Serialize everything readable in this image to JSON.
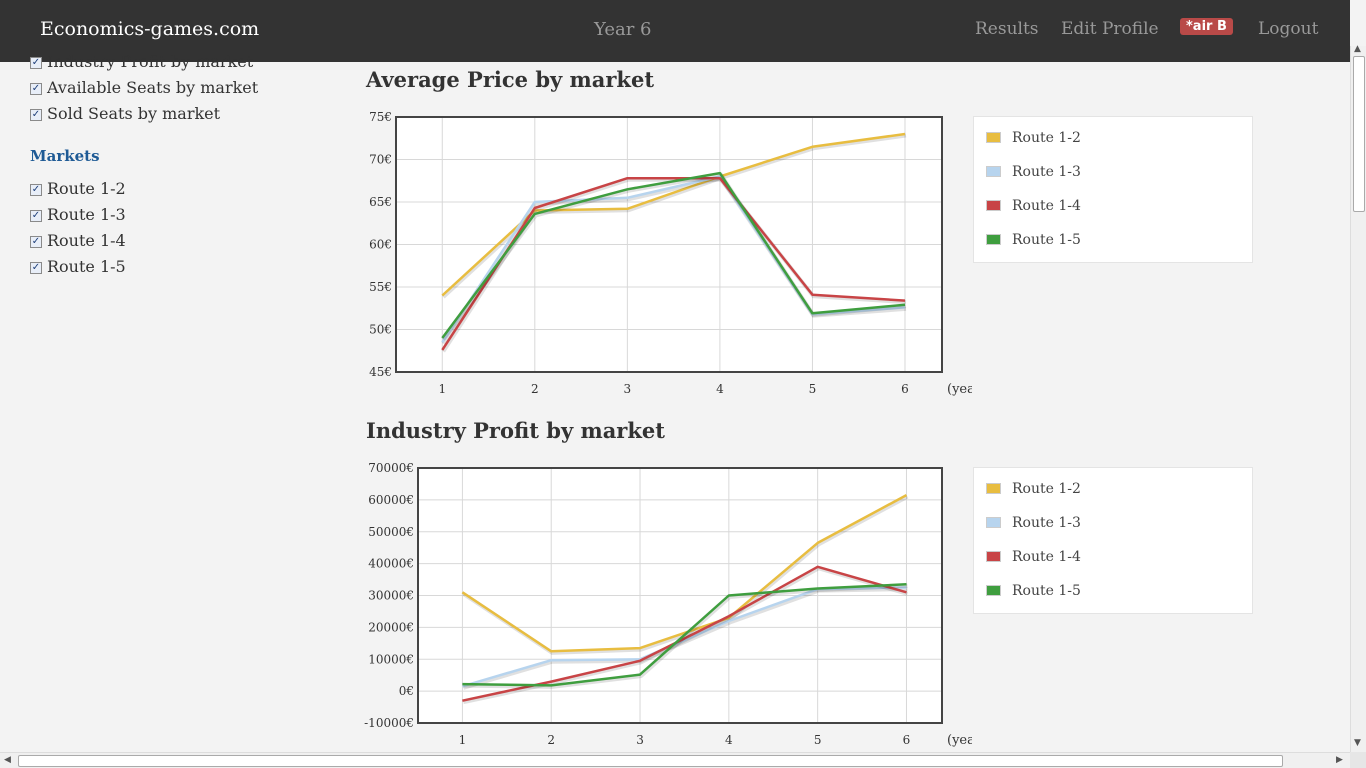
{
  "navbar": {
    "brand": "Economics-games.com",
    "year": "Year 6",
    "links": [
      "Results",
      "Edit Profile",
      "Logout"
    ],
    "badge": "*air B"
  },
  "sidebar": {
    "metric_options": [
      {
        "label": "Industry Profit by market",
        "checked": true
      },
      {
        "label": "Available Seats by market",
        "checked": true
      },
      {
        "label": "Sold Seats by market",
        "checked": true
      }
    ],
    "markets_heading": "Markets",
    "markets": [
      {
        "label": "Route 1-2",
        "checked": true
      },
      {
        "label": "Route 1-3",
        "checked": true
      },
      {
        "label": "Route 1-4",
        "checked": true
      },
      {
        "label": "Route 1-5",
        "checked": true
      }
    ]
  },
  "colors": {
    "route_1_2": "#e8bd40",
    "route_1_3": "#b7d4ee",
    "route_1_4": "#c84446",
    "route_1_5": "#3f9e3f",
    "navbar": "#333333",
    "markets_heading": "#1e5a95",
    "badge": "#b94a48"
  },
  "charts": [
    {
      "title": "Average Price by market",
      "xlabel": "(year)",
      "y_ticks": [
        "75€",
        "70€",
        "65€",
        "60€",
        "55€",
        "50€",
        "45€"
      ],
      "legend": [
        "Route 1-2",
        "Route 1-3",
        "Route 1-4",
        "Route 1-5"
      ]
    },
    {
      "title": "Industry Profit by market",
      "xlabel": "(year)",
      "y_ticks": [
        "70000€",
        "60000€",
        "50000€",
        "40000€",
        "30000€",
        "20000€",
        "10000€",
        "0€",
        "-10000€"
      ],
      "legend": [
        "Route 1-2",
        "Route 1-3",
        "Route 1-4",
        "Route 1-5"
      ]
    }
  ],
  "chart_data": [
    {
      "type": "line",
      "title": "Average Price by market",
      "xlabel": "(year)",
      "ylabel": "",
      "x": [
        1,
        2,
        3,
        4,
        5,
        6
      ],
      "ylim": [
        45,
        75
      ],
      "y_unit": "€",
      "grid": true,
      "legend_position": "right",
      "series": [
        {
          "name": "Route 1-2",
          "values": [
            54,
            64,
            64.2,
            68,
            71.5,
            73
          ]
        },
        {
          "name": "Route 1-3",
          "values": [
            48.5,
            65,
            65.5,
            68,
            51.8,
            52.6
          ]
        },
        {
          "name": "Route 1-4",
          "values": [
            47.6,
            64.3,
            67.8,
            67.8,
            54.1,
            53.4
          ]
        },
        {
          "name": "Route 1-5",
          "values": [
            49,
            63.6,
            66.5,
            68.4,
            51.9,
            52.9
          ]
        }
      ]
    },
    {
      "type": "line",
      "title": "Industry Profit by market",
      "xlabel": "(year)",
      "ylabel": "",
      "x": [
        1,
        2,
        3,
        4,
        5,
        6
      ],
      "ylim": [
        -10000,
        70000
      ],
      "y_unit": "€",
      "grid": true,
      "legend_position": "right",
      "series": [
        {
          "name": "Route 1-2",
          "values": [
            31000,
            12500,
            13500,
            23000,
            46500,
            61500
          ]
        },
        {
          "name": "Route 1-3",
          "values": [
            1500,
            9700,
            10000,
            22000,
            32000,
            32500
          ]
        },
        {
          "name": "Route 1-4",
          "values": [
            -3000,
            3000,
            9500,
            23500,
            39000,
            31000
          ]
        },
        {
          "name": "Route 1-5",
          "values": [
            2200,
            1800,
            5200,
            30000,
            32200,
            33500
          ]
        }
      ]
    }
  ]
}
